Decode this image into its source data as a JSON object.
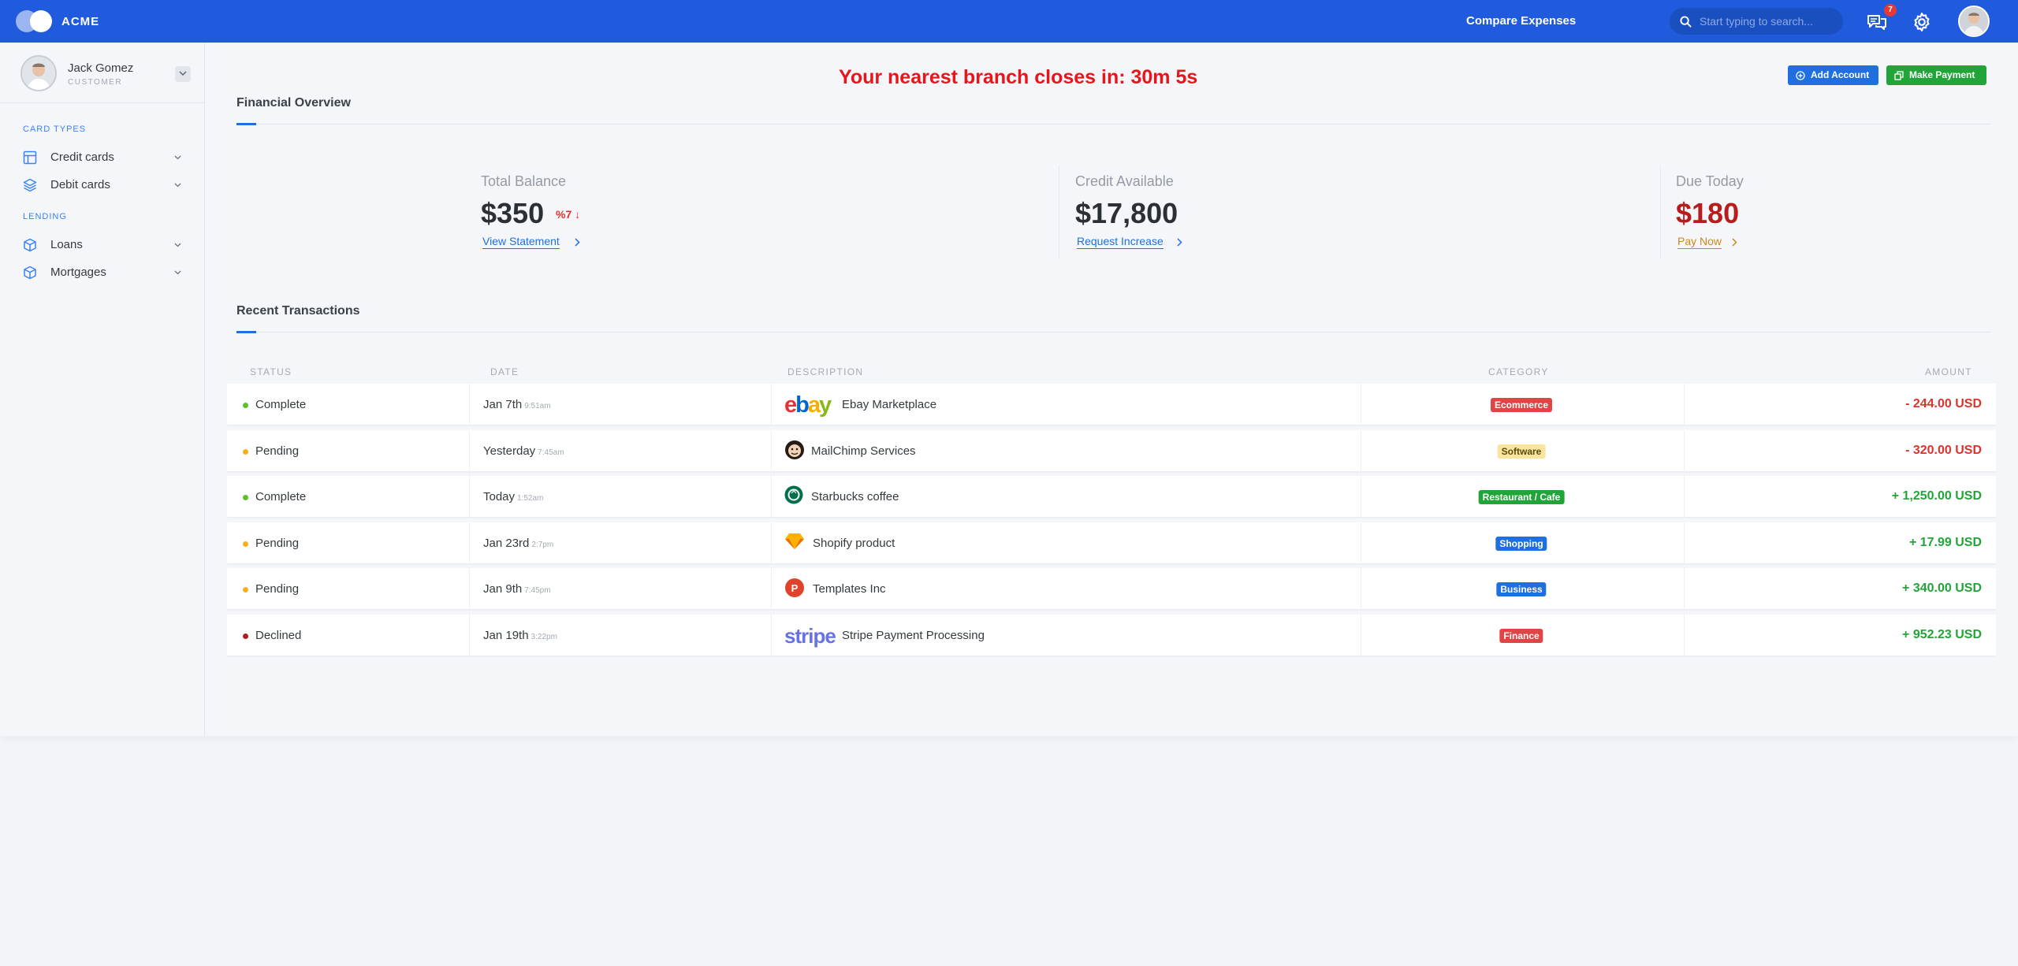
{
  "header": {
    "brand": "ACME",
    "compare_label": "Compare Expenses",
    "search_placeholder": "Start typing to search...",
    "notification_count": "7",
    "icons": [
      "search-icon",
      "chat-icon",
      "gear-icon",
      "avatar"
    ]
  },
  "user": {
    "name": "Jack Gomez",
    "role": "CUSTOMER"
  },
  "sidebar": {
    "sections": [
      {
        "title": "CARD TYPES",
        "items": [
          {
            "label": "Credit cards",
            "icon": "table-icon"
          },
          {
            "label": "Debit cards",
            "icon": "layers-icon"
          }
        ]
      },
      {
        "title": "LENDING",
        "items": [
          {
            "label": "Loans",
            "icon": "box-icon"
          },
          {
            "label": "Mortgages",
            "icon": "box-icon"
          }
        ]
      }
    ]
  },
  "main": {
    "countdown": "Your nearest branch closes in: 30m 5s",
    "add_account_label": "Add Account",
    "make_payment_label": "Make Payment",
    "overview_title": "Financial Overview",
    "stats": [
      {
        "label": "Total Balance",
        "value": "$350",
        "change": "%7 ↓",
        "link": "View Statement"
      },
      {
        "label": "Credit Available",
        "value": "$17,800",
        "link": "Request Increase"
      },
      {
        "label": "Due Today",
        "value": "$180",
        "link": "Pay Now"
      }
    ],
    "transactions_title": "Recent Transactions",
    "columns": [
      "STATUS",
      "DATE",
      "DESCRIPTION",
      "CATEGORY",
      "AMOUNT"
    ],
    "transactions": [
      {
        "status": "Complete",
        "status_color": "#5fbf2a",
        "date": "Jan 7th",
        "time": "9:51am",
        "logo": "ebay-logo",
        "description": "Ebay Marketplace",
        "category": "Ecommerce",
        "category_color": "#e04444",
        "amount": "- 244.00 USD",
        "amount_color": "#e0322c"
      },
      {
        "status": "Pending",
        "status_color": "#f5b021",
        "date": "Yesterday",
        "time": "7:45am",
        "logo": "mailchimp-logo",
        "description": "MailChimp Services",
        "category": "Software",
        "category_color": "#fbe49b",
        "amount": "- 320.00 USD",
        "amount_color": "#e0322c"
      },
      {
        "status": "Complete",
        "status_color": "#5fbf2a",
        "date": "Today",
        "time": "1:52am",
        "logo": "starbucks-logo",
        "description": "Starbucks coffee",
        "category": "Restaurant / Cafe",
        "category_color": "#22a538",
        "amount": "+ 1,250.00 USD",
        "amount_color": "#22a538"
      },
      {
        "status": "Pending",
        "status_color": "#f5b021",
        "date": "Jan 23rd",
        "time": "2:7pm",
        "logo": "sketch-logo",
        "description": "Shopify product",
        "category": "Shopping",
        "category_color": "#1f6fe0",
        "amount": "+ 17.99 USD",
        "amount_color": "#22a538"
      },
      {
        "status": "Pending",
        "status_color": "#f5b021",
        "date": "Jan 9th",
        "time": "7:45pm",
        "logo": "templates-logo",
        "description": "Templates Inc",
        "category": "Business",
        "category_color": "#1f6fe0",
        "amount": "+ 340.00 USD",
        "amount_color": "#22a538"
      },
      {
        "status": "Declined",
        "status_color": "#b01c1c",
        "date": "Jan 19th",
        "time": "3:22pm",
        "logo": "stripe-logo",
        "description": "Stripe Payment Processing",
        "category": "Finance",
        "category_color": "#e04444",
        "amount": "+ 952.23 USD",
        "amount_color": "#22a538"
      }
    ]
  }
}
